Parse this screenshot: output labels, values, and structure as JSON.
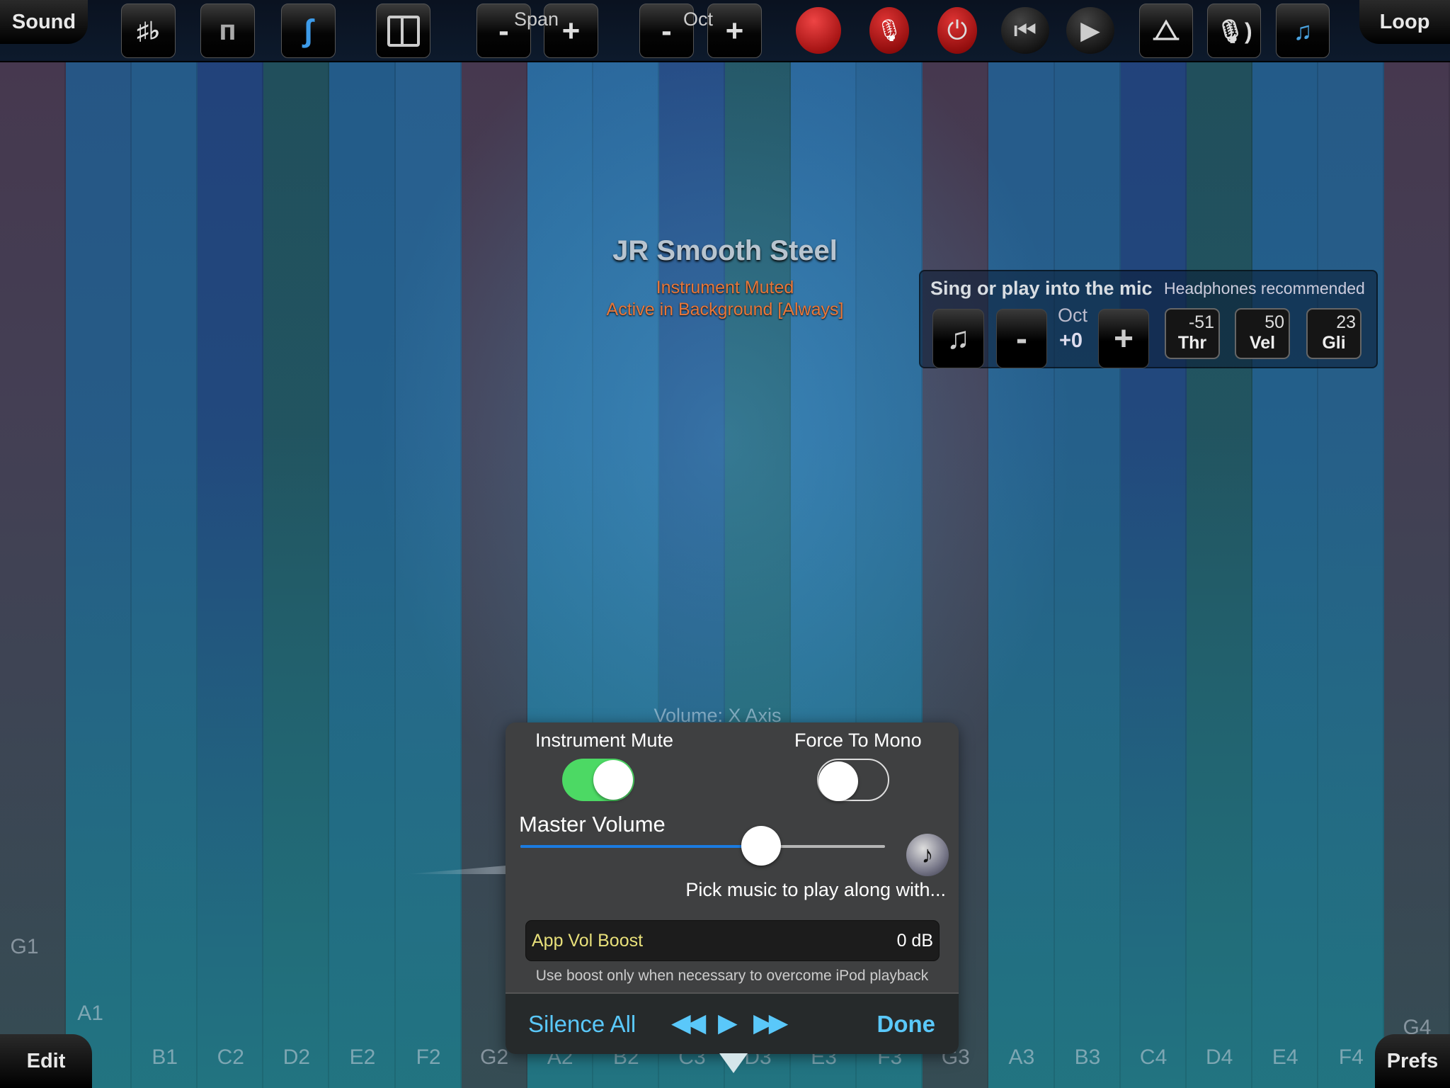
{
  "keyboard": {
    "columns": [
      {
        "note": "G1",
        "color": "#4a3a52"
      },
      {
        "note": "A1",
        "color": "#285a8c"
      },
      {
        "note": "B1",
        "color": "#275f90"
      },
      {
        "note": "C2",
        "color": "#244581"
      },
      {
        "note": "D2",
        "color": "#235260"
      },
      {
        "note": "E2",
        "color": "#255f90"
      },
      {
        "note": "F2",
        "color": "#2a6396"
      },
      {
        "note": "G2",
        "color": "#4a3a52"
      },
      {
        "note": "A2",
        "color": "#2d6fa6"
      },
      {
        "note": "B2",
        "color": "#2c6ba3"
      },
      {
        "note": "C3",
        "color": "#264b88"
      },
      {
        "note": "D3",
        "color": "#245766"
      },
      {
        "note": "E3",
        "color": "#2c6aa2"
      },
      {
        "note": "F3",
        "color": "#2a6599"
      },
      {
        "note": "G3",
        "color": "#4a3a52"
      },
      {
        "note": "A3",
        "color": "#285f92"
      },
      {
        "note": "B3",
        "color": "#275f90"
      },
      {
        "note": "C4",
        "color": "#244581"
      },
      {
        "note": "D4",
        "color": "#235260"
      },
      {
        "note": "E4",
        "color": "#255f90"
      },
      {
        "note": "F4",
        "color": "#285e8e"
      },
      {
        "note": "G4",
        "color": "#4a3a52"
      }
    ]
  },
  "toolbar": {
    "sound_tab": "Sound",
    "loop_tab": "Loop",
    "sharp_flat": "♯♭",
    "span_label": "Span",
    "oct_label": "Oct",
    "minus": "-",
    "plus": "+"
  },
  "bottom": {
    "edit_tab": "Edit",
    "prefs_tab": "Prefs"
  },
  "instrument": {
    "name": "JR Smooth Steel",
    "status1": "Instrument Muted",
    "status2": "Active in Background [Always]"
  },
  "mic_panel": {
    "title": "Sing or play into the mic",
    "hint": "Headphones recommended",
    "oct_label": "Oct",
    "oct_value": "+0",
    "minus": "-",
    "plus": "+",
    "threshold": {
      "value": "-51",
      "label": "Thr"
    },
    "velocity": {
      "value": "50",
      "label": "Vel"
    },
    "glide": {
      "value": "23",
      "label": "Gli"
    }
  },
  "volume_axis_label": "Volume: X Axis",
  "popup": {
    "instrument_mute_label": "Instrument Mute",
    "instrument_mute_on": true,
    "force_mono_label": "Force To Mono",
    "force_mono_on": false,
    "master_volume_label": "Master Volume",
    "master_volume": 0.66,
    "pick_music": "Pick music to play along with...",
    "boost_label": "App Vol Boost",
    "boost_value": "0 dB",
    "boost_hint": "Use boost only when necessary to overcome iPod playback",
    "silence_all": "Silence All",
    "done": "Done",
    "accent": "#5ac8fa",
    "toggle_on_color": "#4cd964"
  }
}
